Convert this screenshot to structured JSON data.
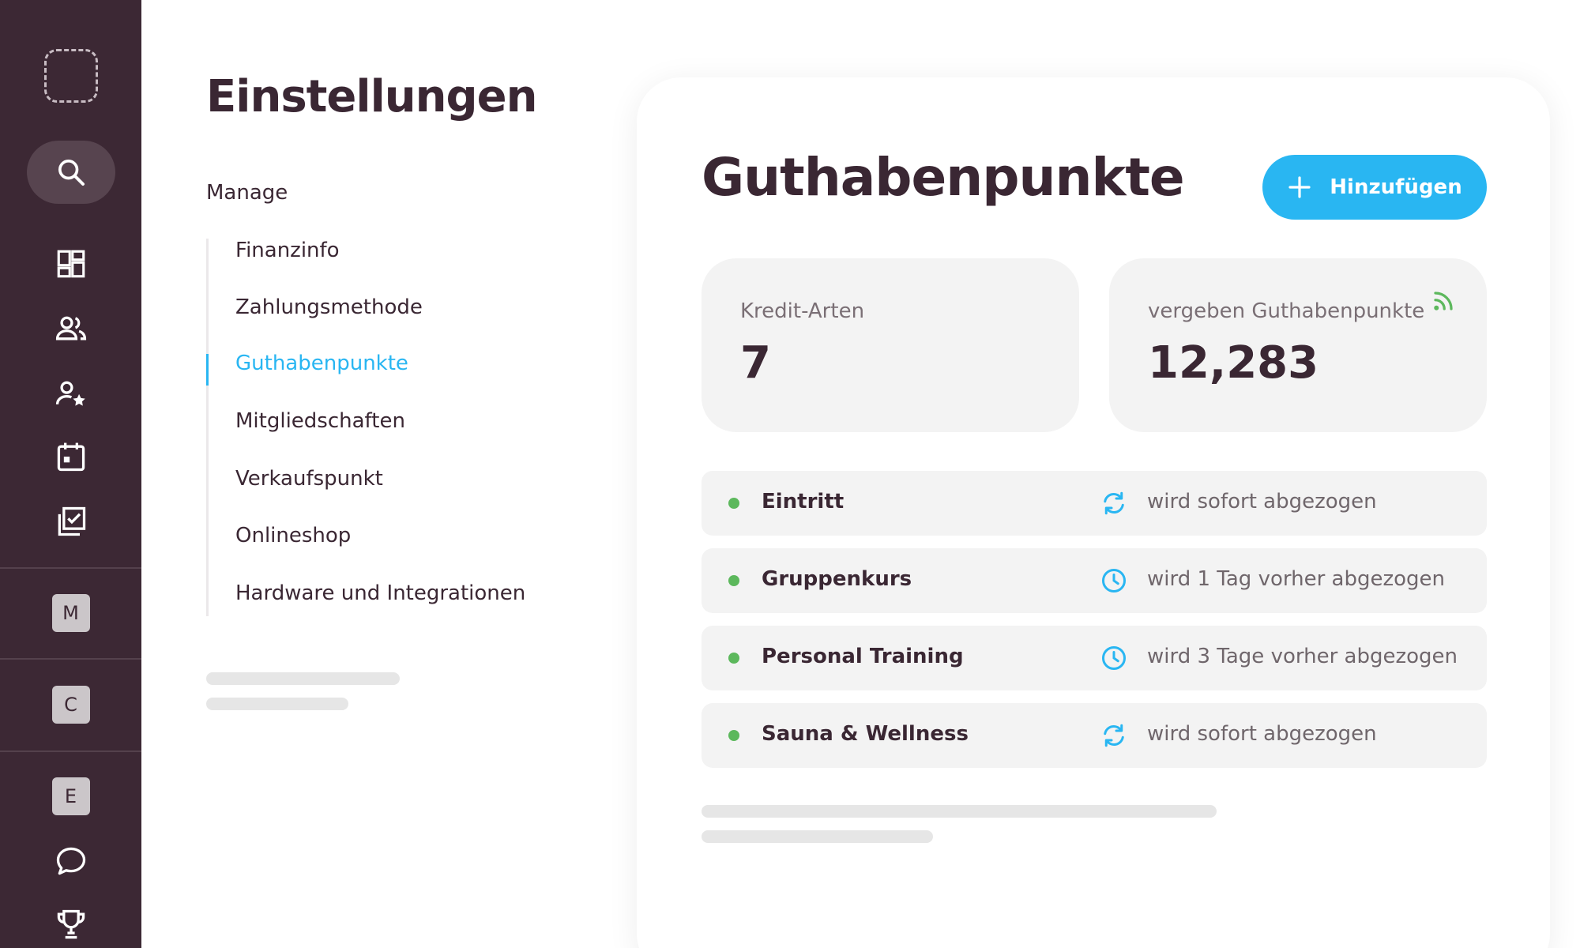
{
  "sidebar": {
    "letter_badges": [
      "M",
      "C",
      "E"
    ]
  },
  "settings": {
    "title": "Einstellungen",
    "section_label": "Manage",
    "nav_items": [
      "Finanzinfo",
      "Zahlungsmethode",
      "Guthabenpunkte",
      "Mitgliedschaften",
      "Verkaufspunkt",
      "Onlineshop",
      "Hardware und Integrationen"
    ],
    "active_item": "Guthabenpunkte"
  },
  "main": {
    "title": "Guthabenpunkte",
    "add_button_label": "Hinzufügen",
    "stats": [
      {
        "label": "Kredit-Arten",
        "value": "7"
      },
      {
        "label": "vergeben Guthabenpunkte",
        "value": "12,283"
      }
    ],
    "credit_types": [
      {
        "name": "Eintritt",
        "rule": "wird sofort abgezogen",
        "icon": "sync-icon"
      },
      {
        "name": "Gruppenkurs",
        "rule": "wird 1 Tag vorher abgezogen",
        "icon": "clock-icon"
      },
      {
        "name": "Personal Training",
        "rule": "wird 3 Tage vorher abgezogen",
        "icon": "clock-icon"
      },
      {
        "name": "Sauna & Wellness",
        "rule": "wird sofort abgezogen",
        "icon": "sync-icon"
      }
    ]
  },
  "colors": {
    "sidebar_bg": "#3c2834",
    "accent": "#29b6f2",
    "status_active": "#5cb85c",
    "text_dark": "#3a2733"
  }
}
